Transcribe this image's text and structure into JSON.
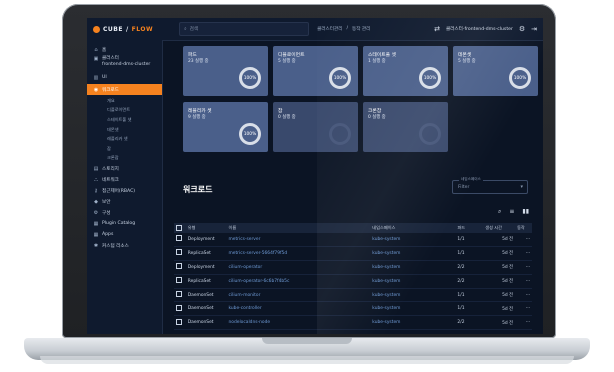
{
  "app": {
    "logo_text": "CUBE",
    "logo_sep": "/",
    "logo_flow": "FLOW",
    "search_placeholder": "검색",
    "breadcrumbs": [
      "클러스터관리",
      "/",
      "동작 관리"
    ],
    "cluster_label": "클러스터-frontend-dms-cluster"
  },
  "sidebar": {
    "items": [
      {
        "icon": "home-icon",
        "glyph": "⌂",
        "label": "홈"
      },
      {
        "icon": "cluster-icon",
        "glyph": "▣",
        "label": "클러스터\nfrontend-dms-cluster"
      },
      {
        "icon": "ui-icon",
        "glyph": "▥",
        "label": "UI"
      },
      {
        "icon": "workload-icon",
        "glyph": "◉",
        "label": "워크로드",
        "active": true
      }
    ],
    "sub_items": [
      "개요",
      "디플로이먼트",
      "스테이트풀 셋",
      "데몬셋",
      "레플리카 셋",
      "잡",
      "크론잡"
    ],
    "bottom_items": [
      {
        "icon": "storage-icon",
        "glyph": "▤",
        "label": "스토리지"
      },
      {
        "icon": "network-icon",
        "glyph": "⛬",
        "label": "네트워크"
      },
      {
        "icon": "access-icon",
        "glyph": "⚷",
        "label": "접근제어(RBAC)"
      },
      {
        "icon": "security-icon",
        "glyph": "◆",
        "label": "보안"
      },
      {
        "icon": "setting-icon",
        "glyph": "⚙",
        "label": "구성"
      },
      {
        "icon": "plugin-icon",
        "glyph": "▦",
        "label": "Plugin Catalog"
      },
      {
        "icon": "apps-icon",
        "glyph": "▦",
        "label": "Apps"
      },
      {
        "icon": "custom-resource-icon",
        "glyph": "✱",
        "label": "커스텀 리소스"
      }
    ]
  },
  "cards": [
    {
      "title": "파드",
      "sub": "23 실행 중",
      "pct": "100%",
      "filled": true
    },
    {
      "title": "디플로이먼트",
      "sub": "5 실행 중",
      "pct": "100%",
      "filled": true
    },
    {
      "title": "스테이트풀 셋",
      "sub": "1 실행 중",
      "pct": "100%",
      "filled": true
    },
    {
      "title": "데몬셋",
      "sub": "5 실행 중",
      "pct": "100%",
      "filled": true
    },
    {
      "title": "레플리카 셋",
      "sub": "9 실행 중",
      "pct": "100%",
      "filled": true
    },
    {
      "title": "잡",
      "sub": "0 실행 중",
      "pct": "",
      "filled": false
    },
    {
      "title": "크론잡",
      "sub": "0 실행 중",
      "pct": "",
      "filled": false
    }
  ],
  "workloads": {
    "title": "워크로드",
    "filter_label": "네임스페이스",
    "filter_value": "Filter",
    "columns": [
      "유형",
      "이름",
      "네임스페이스",
      "파드",
      "생성 시간",
      "동작"
    ],
    "rows": [
      {
        "type": "Deployment",
        "name": "metrics-server",
        "ns": "kube-system",
        "pods": "1/1",
        "age": "5d 전"
      },
      {
        "type": "ReplicaSet",
        "name": "metrics-server-5664f79f5d",
        "ns": "kube-system",
        "pods": "1/1",
        "age": "5d 전"
      },
      {
        "type": "Deployment",
        "name": "cilium-operator",
        "ns": "kube-system",
        "pods": "2/2",
        "age": "5d 전"
      },
      {
        "type": "ReplicaSet",
        "name": "cilium-operator-6c6b7f4b5c",
        "ns": "kube-system",
        "pods": "2/2",
        "age": "5d 전"
      },
      {
        "type": "DaemonSet",
        "name": "cilium-monitor",
        "ns": "kube-system",
        "pods": "1/1",
        "age": "5d 전"
      },
      {
        "type": "DaemonSet",
        "name": "kube-controller",
        "ns": "kube-system",
        "pods": "1/1",
        "age": "5d 전"
      },
      {
        "type": "DaemonSet",
        "name": "nodelocaldns-node",
        "ns": "kube-system",
        "pods": "2/2",
        "age": "5d 전"
      }
    ],
    "action_glyph": "···"
  }
}
